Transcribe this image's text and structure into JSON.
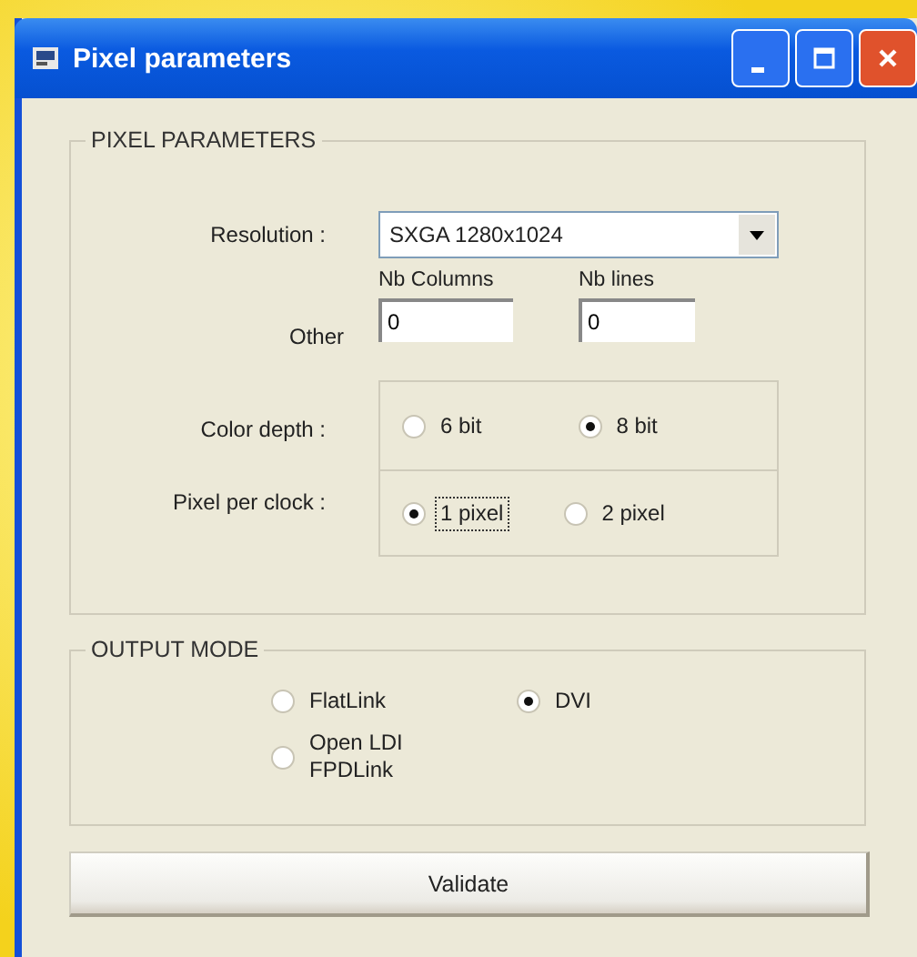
{
  "window": {
    "title": "Pixel parameters"
  },
  "pixel_parameters": {
    "title": "PIXEL PARAMETERS",
    "resolution": {
      "label": "Resolution :",
      "value": "SXGA 1280x1024"
    },
    "other": {
      "label": "Other",
      "fields": [
        {
          "label": "Nb Columns",
          "value": "0"
        },
        {
          "label": "Nb lines",
          "value": "0"
        }
      ]
    },
    "color_depth": {
      "label": "Color depth :",
      "options": [
        {
          "label": "6 bit",
          "selected": false
        },
        {
          "label": "8 bit",
          "selected": true
        }
      ]
    },
    "pixel_per_clock": {
      "label": "Pixel per clock :",
      "options": [
        {
          "label": "1 pixel",
          "selected": true,
          "focused": true
        },
        {
          "label": "2 pixel",
          "selected": false,
          "focused": false
        }
      ]
    }
  },
  "output_mode": {
    "title": "OUTPUT MODE",
    "options": [
      {
        "label": "FlatLink",
        "selected": false
      },
      {
        "label": "DVI",
        "selected": true
      },
      {
        "label": "Open LDI\nFPDLink",
        "selected": false
      }
    ]
  },
  "buttons": [
    "Validate"
  ]
}
